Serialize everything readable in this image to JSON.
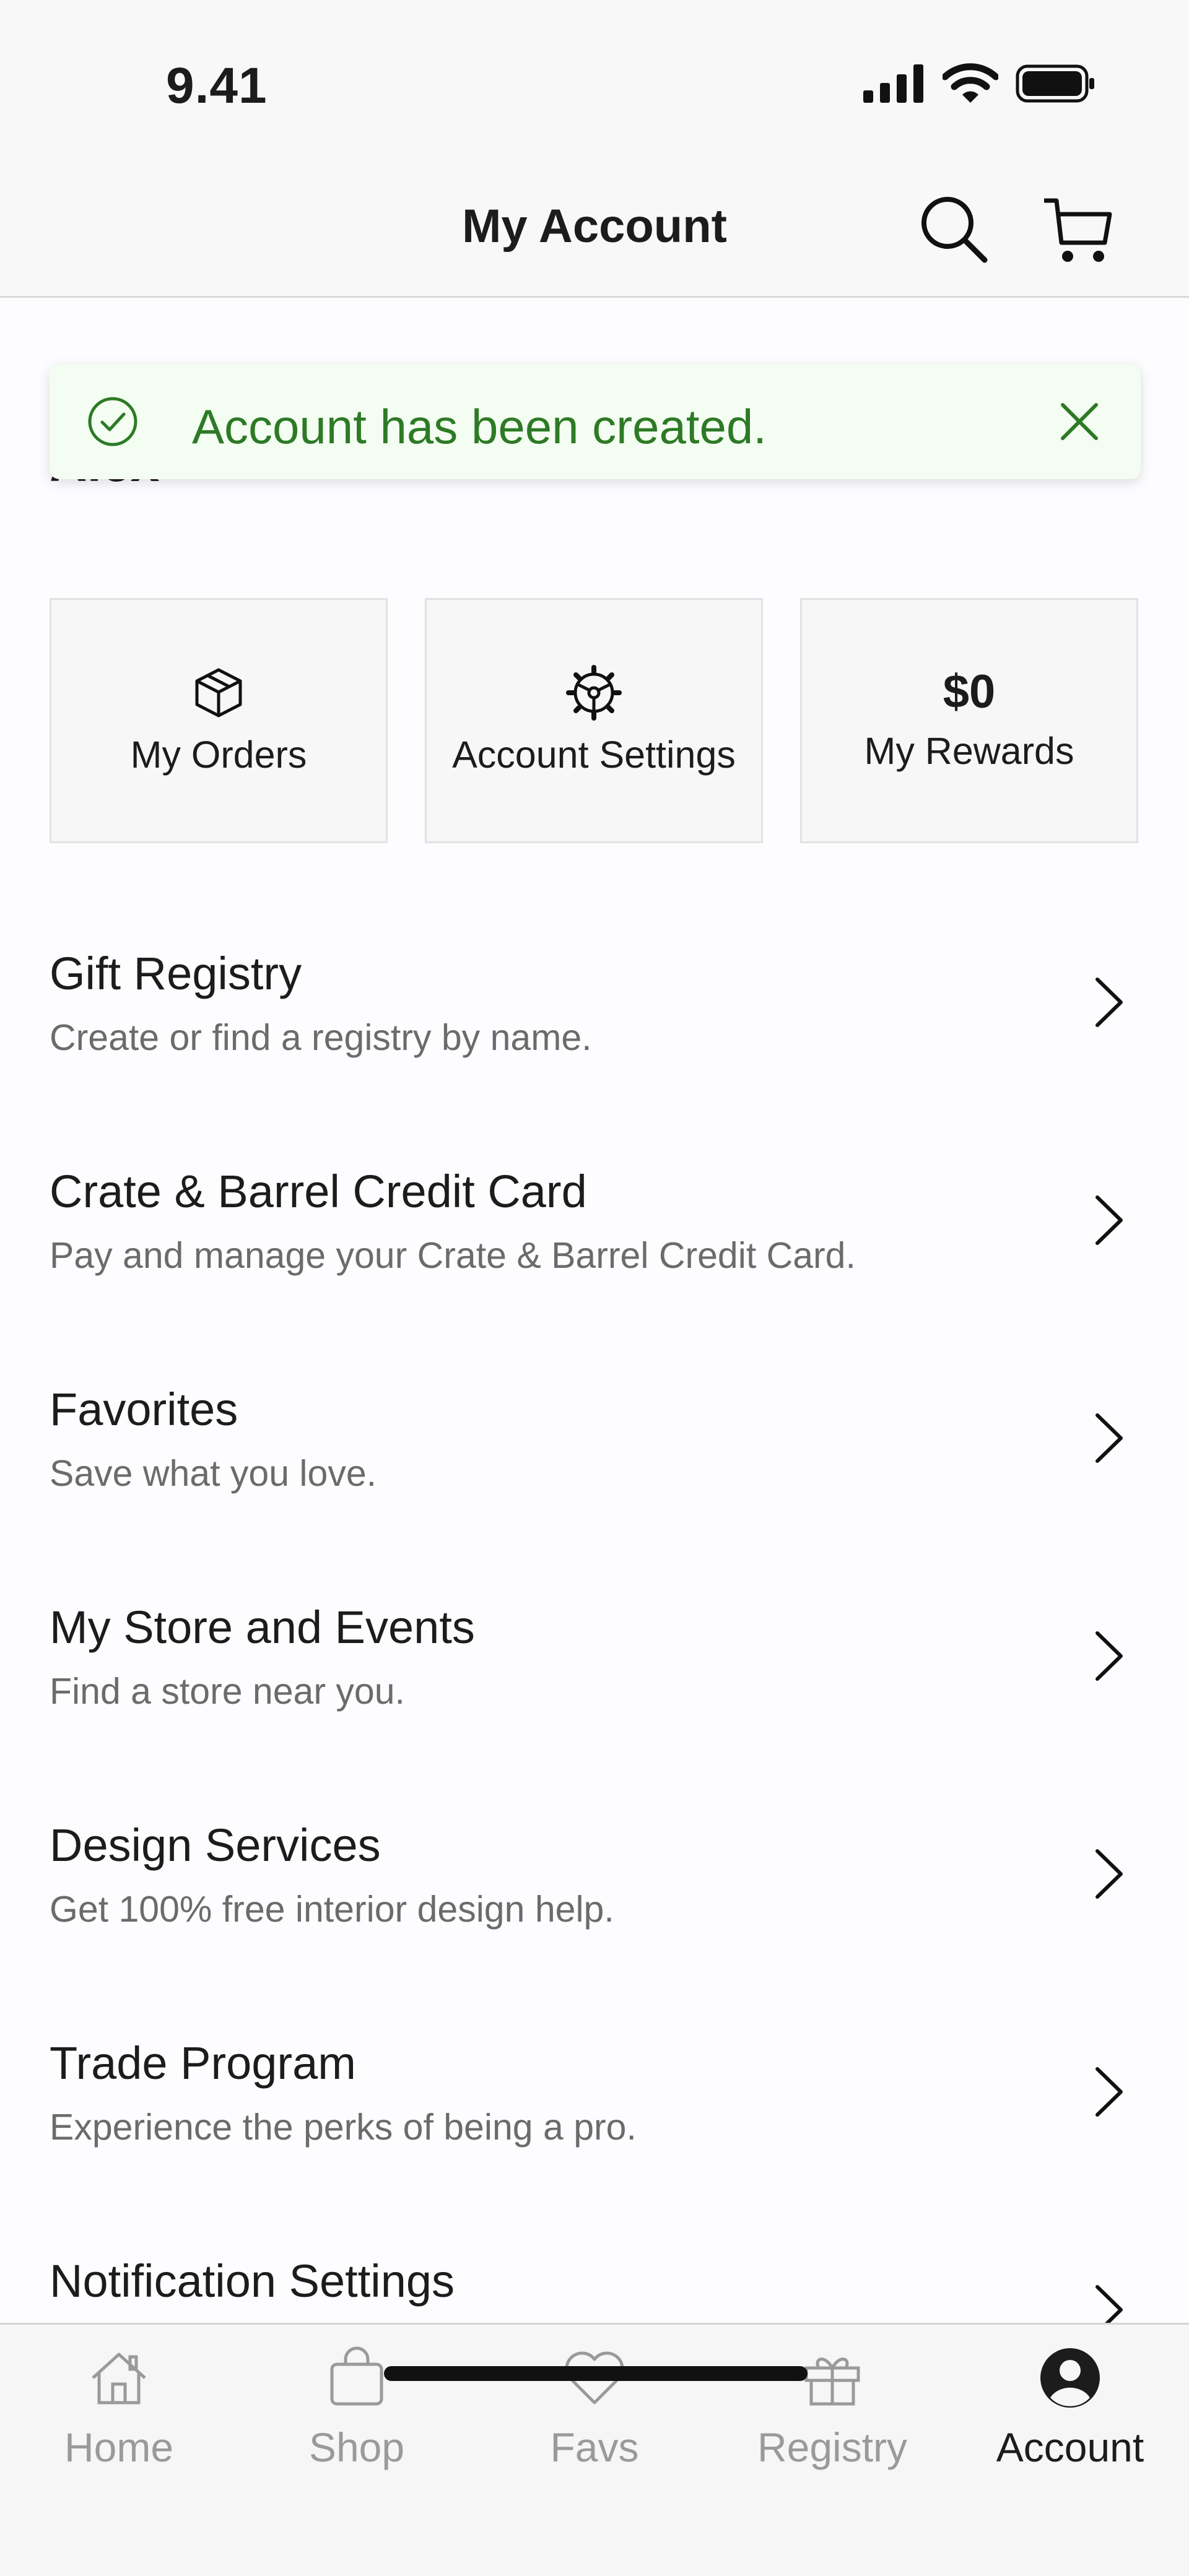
{
  "status_bar": {
    "time": "9.41"
  },
  "header": {
    "title": "My Account"
  },
  "greeting": "Alex",
  "toast": {
    "message": "Account has been created."
  },
  "tiles": [
    {
      "label": "My Orders",
      "icon": "box-icon"
    },
    {
      "label": "Account Settings",
      "icon": "gear-icon"
    },
    {
      "value": "$0",
      "label": "My Rewards"
    }
  ],
  "menu": [
    {
      "title": "Gift Registry",
      "subtitle": "Create or find a registry by name."
    },
    {
      "title": "Crate & Barrel Credit Card",
      "subtitle": "Pay and manage your Crate & Barrel Credit Card."
    },
    {
      "title": "Favorites",
      "subtitle": "Save what you love."
    },
    {
      "title": "My Store and Events",
      "subtitle": "Find a store near you."
    },
    {
      "title": "Design Services",
      "subtitle": "Get 100% free interior design help."
    },
    {
      "title": "Trade Program",
      "subtitle": "Experience the perks of being a pro."
    },
    {
      "title": "Notification Settings",
      "subtitle": ""
    }
  ],
  "tabbar": {
    "active": "Account",
    "tabs": [
      {
        "label": "Home",
        "icon": "home-icon"
      },
      {
        "label": "Shop",
        "icon": "shopping-bag-icon"
      },
      {
        "label": "Favs",
        "icon": "heart-icon"
      },
      {
        "label": "Registry",
        "icon": "gift-icon"
      },
      {
        "label": "Account",
        "icon": "account-icon"
      }
    ]
  },
  "colors": {
    "toast_bg": "#f4fdf1",
    "toast_text": "#2d7a26",
    "inactive_tab": "#9a9a9a"
  }
}
